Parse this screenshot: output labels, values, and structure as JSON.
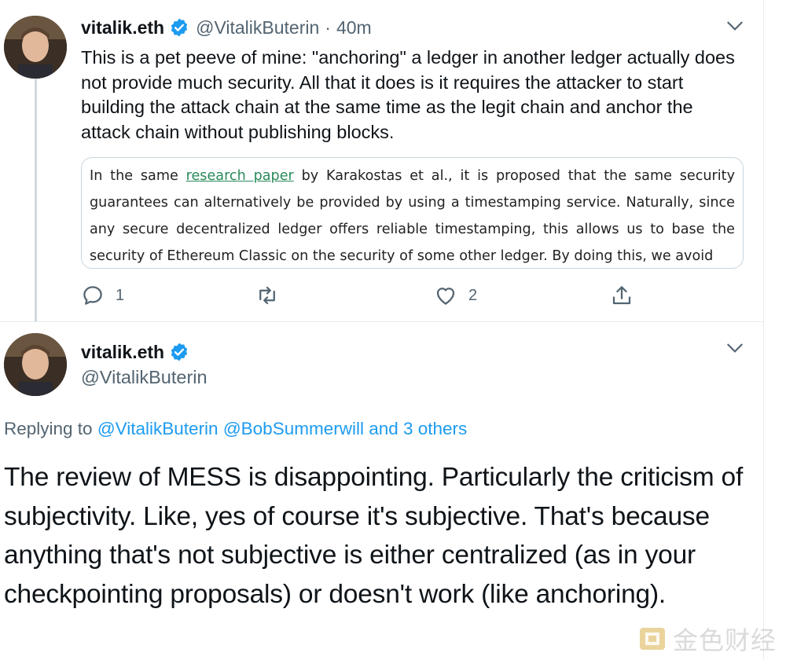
{
  "tweet1": {
    "author_name": "vitalik.eth",
    "handle": "@VitalikButerin",
    "separator": "·",
    "time": "40m",
    "text": "This is a pet peeve of mine: \"anchoring\" a ledger in another ledger actually does not provide much security. All that it does is it requires the attacker to start building the attack chain at the same time as the legit chain and anchor the attack chain without publishing blocks.",
    "quote": {
      "before_link": "In the same ",
      "link_text": "research paper",
      "after_link": " by Karakostas et al., it is proposed that the same security guarantees can alternatively be provided by using a timestamping service. Naturally, since any secure decentralized ledger offers reliable timestamping, this allows us to base the security of Ethereum Classic on the security of some other ledger. By doing this, we avoid"
    },
    "actions": {
      "reply_count": "1",
      "like_count": "2"
    }
  },
  "tweet2": {
    "author_name": "vitalik.eth",
    "handle": "@VitalikButerin",
    "replying_prefix": "Replying to ",
    "replying_mentions": "@VitalikButerin @BobSummerwill and 3 others",
    "text": "The review of MESS is disappointing. Particularly the criticism of subjectivity. Like, yes of course it's subjective. That's because anything that's not subjective is either centralized (as in your checkpointing proposals) or doesn't work (like anchoring)."
  },
  "watermark": {
    "text": "金色财经"
  },
  "colors": {
    "text": "#0f1419",
    "secondary": "#536471",
    "link": "#1d9bf0",
    "verified": "#1d9bf0",
    "quote_link": "#2a8a5a"
  }
}
